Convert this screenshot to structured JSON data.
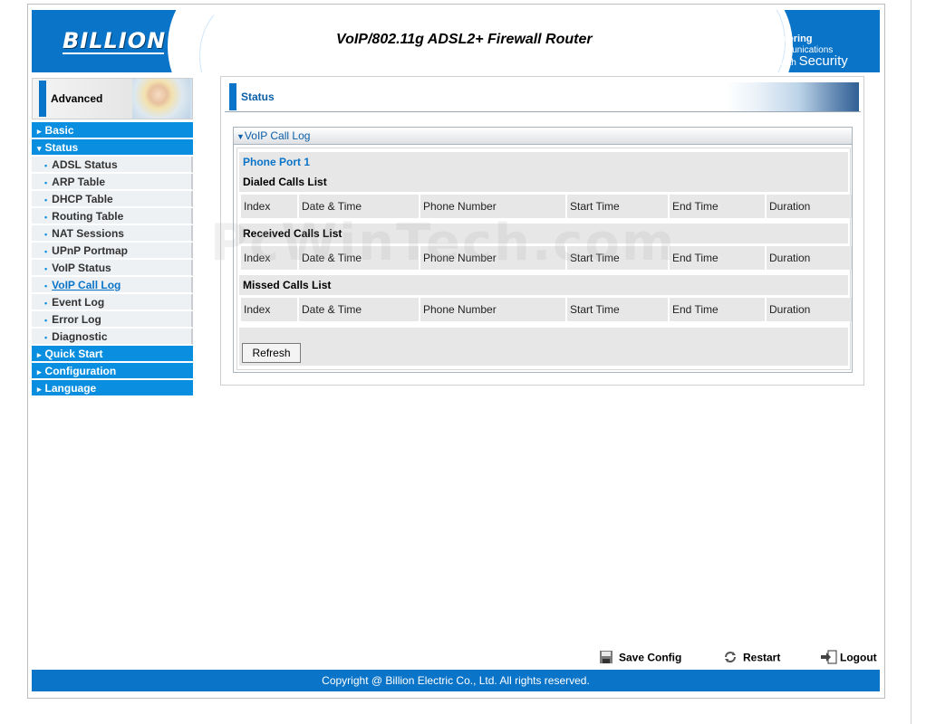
{
  "header": {
    "logo": "BILLION",
    "product_title": "VoIP/802.11g ADSL2+ Firewall Router",
    "tagline_powering": "Powering",
    "tagline_communications": "communications",
    "tagline_with": "with",
    "tagline_security": "Security"
  },
  "sidebar": {
    "advanced_label": "Advanced",
    "items": [
      {
        "label": "Basic",
        "type": "main",
        "arrow": "▸"
      },
      {
        "label": "Status",
        "type": "main",
        "arrow": "▾"
      },
      {
        "label": "ADSL Status",
        "type": "sub"
      },
      {
        "label": "ARP Table",
        "type": "sub"
      },
      {
        "label": "DHCP Table",
        "type": "sub"
      },
      {
        "label": "Routing Table",
        "type": "sub"
      },
      {
        "label": "NAT Sessions",
        "type": "sub"
      },
      {
        "label": "UPnP Portmap",
        "type": "sub"
      },
      {
        "label": "VoIP Status",
        "type": "sub"
      },
      {
        "label": "VoIP Call Log",
        "type": "sub",
        "active": true
      },
      {
        "label": "Event Log",
        "type": "sub"
      },
      {
        "label": "Error Log",
        "type": "sub"
      },
      {
        "label": "Diagnostic",
        "type": "sub"
      },
      {
        "label": "Quick Start",
        "type": "main",
        "arrow": "▸"
      },
      {
        "label": "Configuration",
        "type": "main",
        "arrow": "▸"
      },
      {
        "label": "Language",
        "type": "main",
        "arrow": "▸"
      }
    ]
  },
  "main": {
    "section_title": "Status",
    "panel_title": "VoIP Call Log",
    "port_label": "Phone Port 1",
    "lists": [
      {
        "title": "Dialed Calls List"
      },
      {
        "title": "Received Calls List"
      },
      {
        "title": "Missed Calls List"
      }
    ],
    "columns": [
      "Index",
      "Date & Time",
      "Phone Number",
      "Start Time",
      "End Time",
      "Duration"
    ],
    "refresh_label": "Refresh"
  },
  "watermark": "PcWinTech.com",
  "footer": {
    "save_config": "Save Config",
    "restart": "Restart",
    "logout": "Logout",
    "copyright": "Copyright @ Billion Electric Co., Ltd. All rights reserved."
  },
  "colors": {
    "brand_blue": "#0a74c8",
    "nav_blue": "#0a8fe0",
    "panel_gray": "#e7e7e7"
  }
}
